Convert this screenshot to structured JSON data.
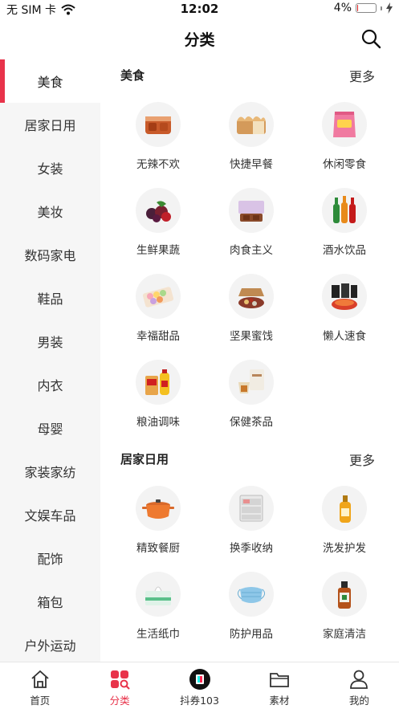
{
  "status_bar": {
    "carrier": "无 SIM 卡",
    "time": "12:02",
    "battery_text": "4%",
    "battery_level": 0.04
  },
  "navbar": {
    "title": "分类"
  },
  "sidebar": {
    "items": [
      {
        "label": "美食",
        "active": true
      },
      {
        "label": "居家日用"
      },
      {
        "label": "女装"
      },
      {
        "label": "美妆"
      },
      {
        "label": "数码家电"
      },
      {
        "label": "鞋品"
      },
      {
        "label": "男装"
      },
      {
        "label": "内衣"
      },
      {
        "label": "母婴"
      },
      {
        "label": "家装家纺"
      },
      {
        "label": "文娱车品"
      },
      {
        "label": "配饰"
      },
      {
        "label": "箱包"
      },
      {
        "label": "户外运动"
      }
    ]
  },
  "sections": [
    {
      "title": "美食",
      "more": "更多",
      "items": [
        {
          "label": "无辣不欢",
          "icon": "spicy-meat-icon"
        },
        {
          "label": "快捷早餐",
          "icon": "bread-icon"
        },
        {
          "label": "休闲零食",
          "icon": "snack-bag-icon"
        },
        {
          "label": "生鲜果蔬",
          "icon": "berries-icon"
        },
        {
          "label": "肉食主义",
          "icon": "meat-box-icon"
        },
        {
          "label": "酒水饮品",
          "icon": "bottles-icon"
        },
        {
          "label": "幸福甜品",
          "icon": "macaron-icon"
        },
        {
          "label": "坚果蜜饯",
          "icon": "nuts-icon"
        },
        {
          "label": "懒人速食",
          "icon": "instant-food-icon"
        },
        {
          "label": "粮油调味",
          "icon": "oil-rice-icon"
        },
        {
          "label": "保健茶品",
          "icon": "tea-icon"
        }
      ]
    },
    {
      "title": "居家日用",
      "more": "更多",
      "items": [
        {
          "label": "精致餐厨",
          "icon": "pot-icon"
        },
        {
          "label": "换季收纳",
          "icon": "drawer-icon"
        },
        {
          "label": "洗发护发",
          "icon": "shampoo-icon"
        },
        {
          "label": "生活纸巾",
          "icon": "tissue-icon"
        },
        {
          "label": "防护用品",
          "icon": "mask-icon"
        },
        {
          "label": "家庭清洁",
          "icon": "disinfectant-icon"
        }
      ]
    }
  ],
  "tabbar": {
    "tabs": [
      {
        "label": "首页",
        "icon": "home-icon"
      },
      {
        "label": "分类",
        "icon": "category-icon",
        "active": true
      },
      {
        "label": "抖券103",
        "icon": "tiktok-coupon-icon"
      },
      {
        "label": "素材",
        "icon": "folder-icon"
      },
      {
        "label": "我的",
        "icon": "profile-icon"
      }
    ]
  },
  "colors": {
    "accent": "#e8334a",
    "sidebar_bg": "#f6f6f6"
  }
}
